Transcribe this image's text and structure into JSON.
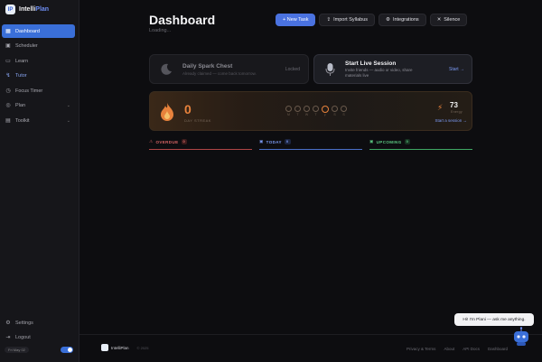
{
  "app": {
    "brand_first": "Intelli",
    "brand_second": "Plan",
    "brand_logo_text": "IP"
  },
  "sidebar": {
    "items": [
      {
        "label": "Dashboard",
        "icon": "grid-icon"
      },
      {
        "label": "Scheduler",
        "icon": "calendar-icon"
      },
      {
        "label": "Learn",
        "icon": "book-icon"
      },
      {
        "label": "Tutor",
        "icon": "tutor-icon"
      },
      {
        "label": "Focus Timer",
        "icon": "timer-icon"
      },
      {
        "label": "Plan",
        "icon": "target-icon"
      },
      {
        "label": "Toolkit",
        "icon": "toolbox-icon"
      }
    ],
    "bottom": [
      {
        "label": "Settings",
        "icon": "gear-icon"
      },
      {
        "label": "Logout",
        "icon": "logout-icon"
      }
    ],
    "timezone": "Fri May 02"
  },
  "header": {
    "title": "Dashboard",
    "subtitle": "Loading...",
    "buttons": {
      "new_task": "+ New Task",
      "import": "Import Syllabus",
      "integrations": "Integrations",
      "silence": "Silence"
    }
  },
  "spark": {
    "title": "Daily Spark Chest",
    "subtitle": "Already claimed — come back tomorrow.",
    "status": "Locked"
  },
  "live": {
    "title": "Start Live Session",
    "subtitle": "Invite friends — audio or video, share materials live",
    "link": "Start →"
  },
  "streak": {
    "value": "0",
    "label": "DAY STREAK",
    "days": [
      "M",
      "T",
      "W",
      "T",
      "F",
      "S",
      "S"
    ],
    "today_index": 4,
    "xp_value": "73",
    "xp_label": "Energy",
    "link": "Start a session →"
  },
  "tasks": {
    "overdue": {
      "label": "OVERDUE",
      "count": "0"
    },
    "today": {
      "label": "TODAY",
      "count": "0"
    },
    "upcoming": {
      "label": "UPCOMING",
      "count": "0"
    }
  },
  "footer": {
    "brand": "IntelliPlan",
    "copyright": "© 2025",
    "links": [
      "Privacy & Terms",
      "About",
      "API Docs",
      "Dashboard"
    ]
  },
  "chat": {
    "bubble": "Hi! I'm Plani — ask me anything."
  },
  "colors": {
    "accent": "#4a72e0",
    "streak": "#e8823c",
    "overdue": "#d86464",
    "today": "#7c9bf5",
    "upcoming": "#5cc882"
  }
}
